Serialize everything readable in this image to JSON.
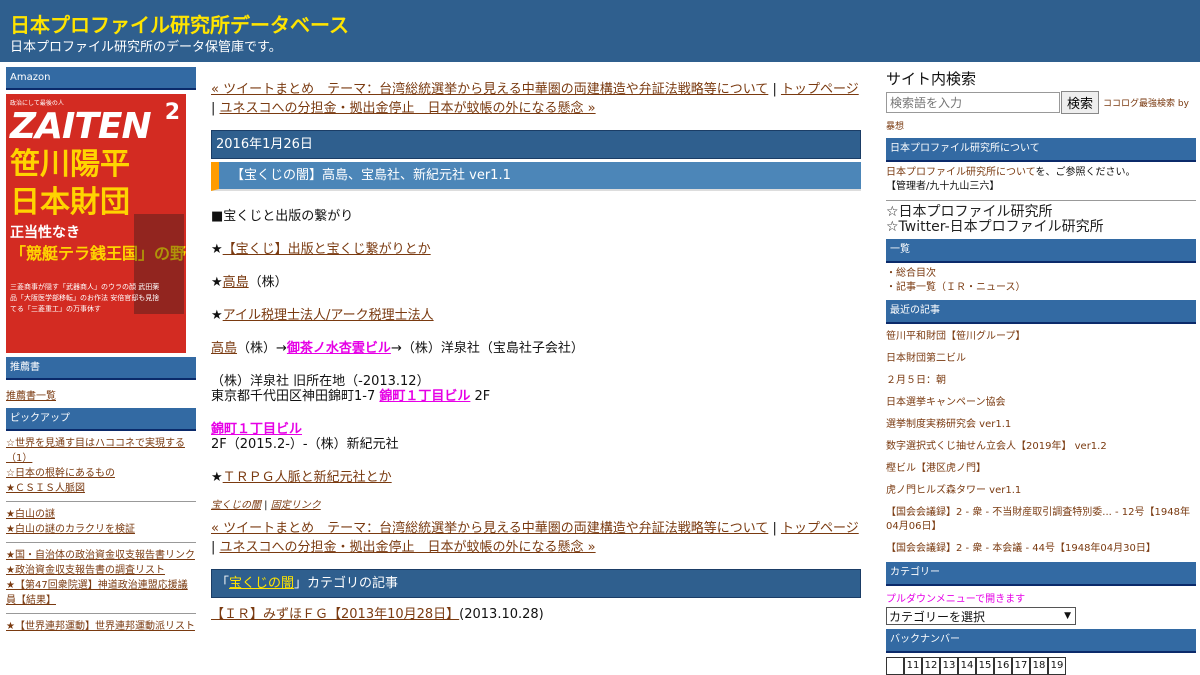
{
  "header": {
    "title": "日本プロファイル研究所データベース",
    "description": "日本プロファイル研究所のデータ保管庫です。"
  },
  "left": {
    "amazon_title": "Amazon",
    "book_cover": {
      "top_small": "政治にして最後の人",
      "masthead": "ZAITEN",
      "issue": "2",
      "headline_1": "笹川陽平",
      "headline_2": "日本財団",
      "sub_1": "正当性なき",
      "sub_2": "「競艇テラ銭王国」の野望",
      "small_text": "三菱商事が隠す「武器商人」のウラの顔 武田薬品「大阪医学部移転」のお作法 安倍官邸も見捨てる「三菱重工」の万事休す"
    },
    "recommended_title": "推薦書",
    "recommended_link": "推薦書一覧",
    "pickup_title": "ピックアップ",
    "pickup_groups": [
      [
        "☆世界を見通す目はハココネで実現する（1）",
        "☆日本の根幹にあるもの",
        "★ＣＳＩＳ人脈図"
      ],
      [
        "★白山の謎",
        "★白山の謎のカラクリを検証"
      ],
      [
        "★国・自治体の政治資金収支報告書リンク",
        "★政治資金収支報告書の調査リスト",
        "★【第47回衆院選】神道政治連盟応援議員【結果】"
      ],
      [
        "★【世界連邦運動】世界連邦運動派リスト"
      ]
    ]
  },
  "center": {
    "nav_prev": "« ツイートまとめ　テーマ：台湾総統選挙から見える中華圏の両建構造や弁証法戦略等について",
    "nav_sep": " | ",
    "nav_top": "トップページ",
    "nav_next": "ユネスコへの分担金・拠出金停止　日本が蚊帳の外になる懸念 »",
    "date": "2016年1月26日",
    "entry_title": "【宝くじの闇】高島、宝島社、新紀元社 ver1.1",
    "body": {
      "p1": "■宝くじと出版の繋がり",
      "p2_star": "★",
      "p2_link": "【宝くじ】出版と宝くじ繋がりとか",
      "p3_star": "★",
      "p3_link": "高島",
      "p3_rest": "（株）",
      "p4_star": "★",
      "p4_link": "アイル税理士法人/アーク税理士法人",
      "p5_link": "高島",
      "p5_mid": "（株）→",
      "p5_mag": "御茶ノ水杏雲ビル",
      "p5_rest": "→（株）洋泉社（宝島社子会社）",
      "p6_line1": "（株）洋泉社 旧所在地（-2013.12）",
      "p6_line2_pre": "東京都千代田区神田錦町1-7 ",
      "p6_line2_mag": "錦町１丁目ビル",
      "p6_line2_post": " 2F",
      "p7_mag": "錦町１丁目ビル",
      "p7_line2": "2F（2015.2-）-（株）新紀元社",
      "p8_star": "★",
      "p8_link": "ＴＲＰＧ人脈と新紀元社とか"
    },
    "footer_category": "宝くじの闇",
    "footer_sep": " | ",
    "footer_permalink": "固定リンク",
    "category_bar_pre": "「",
    "category_bar_link": "宝くじの闇",
    "category_bar_post": "」カテゴリの記事",
    "last_entry_link": "【ＩＲ】みずほＦＧ【2013年10月28日】",
    "last_entry_date": "(2013.10.28)"
  },
  "right": {
    "search_title": "サイト内検索",
    "search_placeholder": "検索語を入力",
    "search_button": "検索",
    "search_note": "ココログ最強検索 by",
    "search_note2": "暴想",
    "about_title": "日本プロファイル研究所について",
    "about_link": "日本プロファイル研究所について",
    "about_text": "を、ご参照ください。",
    "manager": "【管理者/九十九山三六】",
    "big_links": [
      "☆日本プロファイル研究所",
      "☆Twitter-日本プロファイル研究所"
    ],
    "list_title": "一覧",
    "list_items": [
      "・総合目次",
      "・記事一覧（ＩＲ・ニュース）"
    ],
    "recent_title": "最近の記事",
    "recent_items": [
      "笹川平和財団【笹川グループ】",
      "日本財団第二ビル",
      "２月５日：朝",
      "日本選挙キャンペーン協会",
      "選挙制度実務研究会 ver1.1",
      "数字選択式くじ抽せん立会人【2019年】 ver1.2",
      "樫ビル【港区虎ノ門】",
      "虎ノ門ヒルズ森タワー ver1.1",
      "【国会会議録】2 - 衆 - 不当財産取引調査特別委... - 12号【1948年04月06日】",
      "【国会会議録】2 - 衆 - 本会議 - 44号【1948年04月30日】"
    ],
    "category_title": "カテゴリー",
    "category_note": "プルダウンメニューで開きます",
    "category_select": "カテゴリーを選択",
    "backnumber_title": "バックナンバー",
    "calendar": [
      "",
      "11",
      "12",
      "13",
      "14",
      "15",
      "16",
      "17",
      "18",
      "19"
    ]
  }
}
